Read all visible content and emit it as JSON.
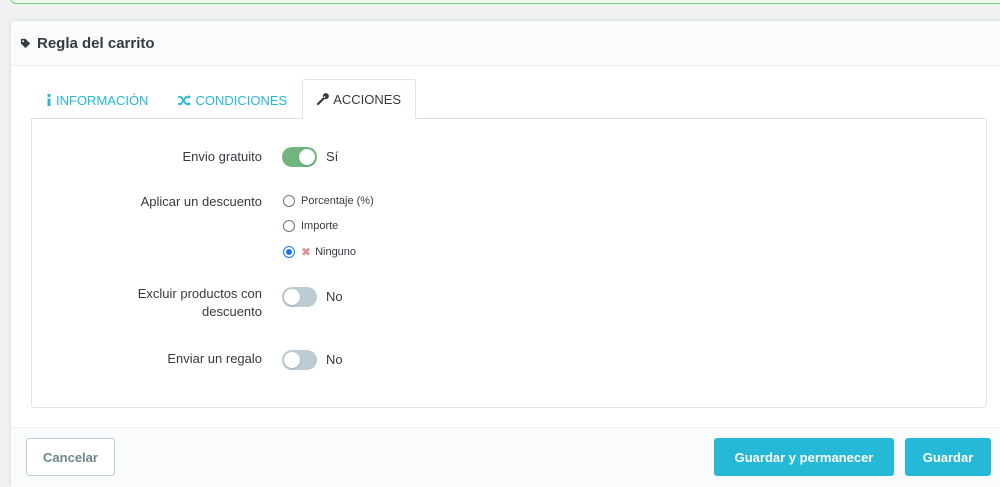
{
  "panel": {
    "title": "Regla del carrito"
  },
  "tabs": [
    {
      "label": "INFORMACIÓN",
      "icon": "info-icon",
      "active": false
    },
    {
      "label": "CONDICIONES",
      "icon": "shuffle-icon",
      "active": false
    },
    {
      "label": "ACCIONES",
      "icon": "wrench-icon",
      "active": true
    }
  ],
  "actions": {
    "free_shipping": {
      "label": "Envio gratuito",
      "state": true,
      "state_text": "Sí"
    },
    "discount": {
      "label": "Aplicar un descuento",
      "options": [
        {
          "label": "Porcentaje (%)",
          "checked": false
        },
        {
          "label": "Importe",
          "checked": false
        },
        {
          "label": "Ninguno",
          "checked": true,
          "icon": "x-icon"
        }
      ]
    },
    "exclude_discounted": {
      "label_line1": "Excluir productos con",
      "label_line2": "descuento",
      "state": false,
      "state_text": "No"
    },
    "send_gift": {
      "label": "Enviar un regalo",
      "state": false,
      "state_text": "No"
    }
  },
  "footer": {
    "cancel_label": "Cancelar",
    "save_stay_label": "Guardar y permanecer",
    "save_label": "Guardar"
  },
  "colors": {
    "accent": "#25b9d7",
    "switch_on": "#70b580",
    "switch_off": "#bbcdd2",
    "alert_border": "#78d07d"
  }
}
